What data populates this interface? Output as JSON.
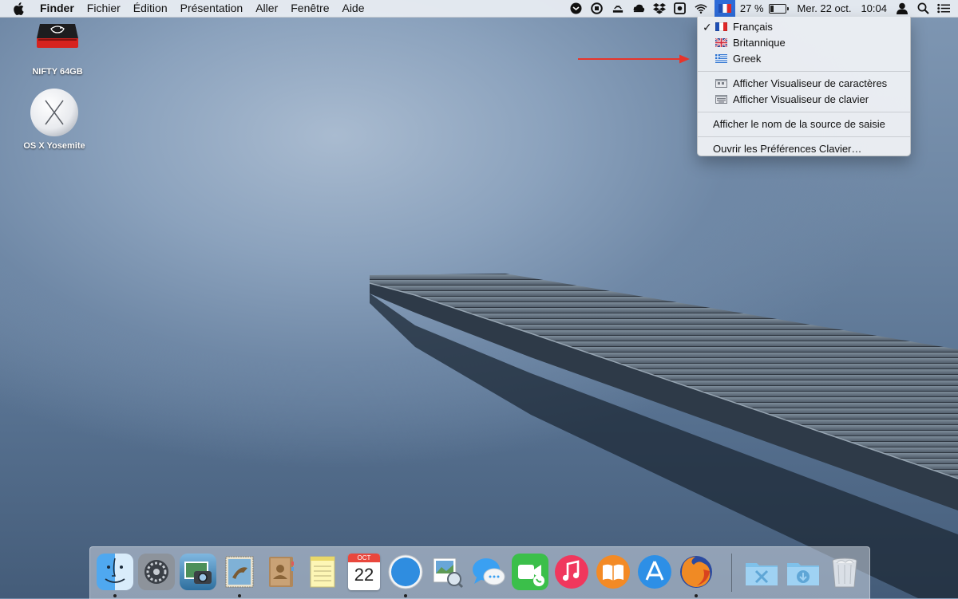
{
  "menubar": {
    "app_name": "Finder",
    "menus": [
      "Fichier",
      "Édition",
      "Présentation",
      "Aller",
      "Fenêtre",
      "Aide"
    ],
    "battery_percent": "27 %",
    "battery_level": 0.27,
    "date": "Mer. 22 oct.",
    "time": "10:04"
  },
  "input_menu": {
    "sources": [
      {
        "label": "Français",
        "checked": true,
        "flag": "france-flag"
      },
      {
        "label": "Britannique",
        "checked": false,
        "flag": "uk-flag"
      },
      {
        "label": "Greek",
        "checked": false,
        "flag": "greece-flag"
      }
    ],
    "show_character_viewer": "Afficher Visualiseur de caractères",
    "show_keyboard_viewer": "Afficher Visualiseur de clavier",
    "show_input_source_name": "Afficher le nom de la source de saisie",
    "open_keyboard_prefs": "Ouvrir les Préférences Clavier…",
    "check_mark": "✓"
  },
  "desktop": {
    "items": [
      {
        "label": "NIFTY 64GB",
        "icon": "external-drive-icon"
      },
      {
        "label": "OS X Yosemite",
        "icon": "installer-disk-icon"
      }
    ]
  },
  "dock": {
    "calendar_month": "OCT",
    "calendar_day": "22",
    "apps": [
      "finder",
      "system-preferences",
      "image-capture",
      "mail",
      "contacts",
      "notes",
      "calendar",
      "safari",
      "preview",
      "messages",
      "facetime",
      "itunes",
      "ibooks",
      "app-store",
      "firefox",
      "applications-folder",
      "downloads-folder",
      "trash"
    ]
  },
  "colors": {
    "menu_highlight": "#2d6bd8",
    "arrow": "#e8342a"
  }
}
